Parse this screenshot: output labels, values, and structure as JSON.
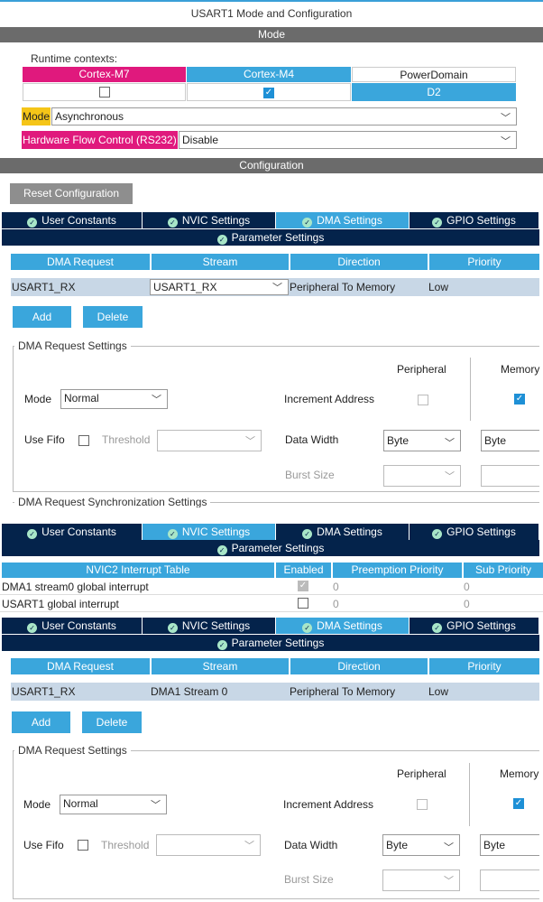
{
  "title": "USART1 Mode and Configuration",
  "mode_section": "Mode",
  "runtime_label": "Runtime contexts:",
  "contexts": [
    {
      "name": "Cortex-M7",
      "color": "#e0197d",
      "checked": false
    },
    {
      "name": "Cortex-M4",
      "color": "#3aa6dc",
      "checked": true
    },
    {
      "name": "PowerDomain",
      "value": "D2"
    }
  ],
  "mode": {
    "label": "Mode",
    "value": "Asynchronous"
  },
  "hw_flow": {
    "label": "Hardware Flow Control (RS232)",
    "value": "Disable"
  },
  "config_section": "Configuration",
  "reset_button": "Reset Configuration",
  "tabs": [
    "User Constants",
    "NVIC Settings",
    "DMA Settings",
    "GPIO Settings"
  ],
  "param_tab": "Parameter Settings",
  "dma_table": {
    "headers": [
      "DMA Request",
      "Stream",
      "Direction",
      "Priority"
    ],
    "row1": {
      "request": "USART1_RX",
      "stream": "USART1_RX",
      "direction": "Peripheral To Memory",
      "priority": "Low"
    },
    "row2": {
      "request": "USART1_RX",
      "stream": "DMA1 Stream 0",
      "direction": "Peripheral To Memory",
      "priority": "Low"
    }
  },
  "add_button": "Add",
  "delete_button": "Delete",
  "dma_settings": {
    "legend": "DMA Request Settings",
    "peripheral_col": "Peripheral",
    "memory_col": "Memory",
    "mode_label": "Mode",
    "mode_value": "Normal",
    "increment_label": "Increment Address",
    "fifo_label": "Use Fifo",
    "threshold_label": "Threshold",
    "data_width_label": "Data Width",
    "periph_width": "Byte",
    "mem_width": "Byte",
    "burst_label": "Burst Size"
  },
  "sync_legend": "DMA Request Synchronization Settings",
  "nvic": {
    "headers": [
      "NVIC2 Interrupt Table",
      "Enabled",
      "Preemption Priority",
      "Sub Priority"
    ],
    "rows": [
      {
        "name": "DMA1 stream0 global interrupt",
        "enabled": true,
        "pre": "0",
        "sub": "0"
      },
      {
        "name": "USART1 global interrupt",
        "enabled": false,
        "pre": "0",
        "sub": "0"
      }
    ]
  }
}
